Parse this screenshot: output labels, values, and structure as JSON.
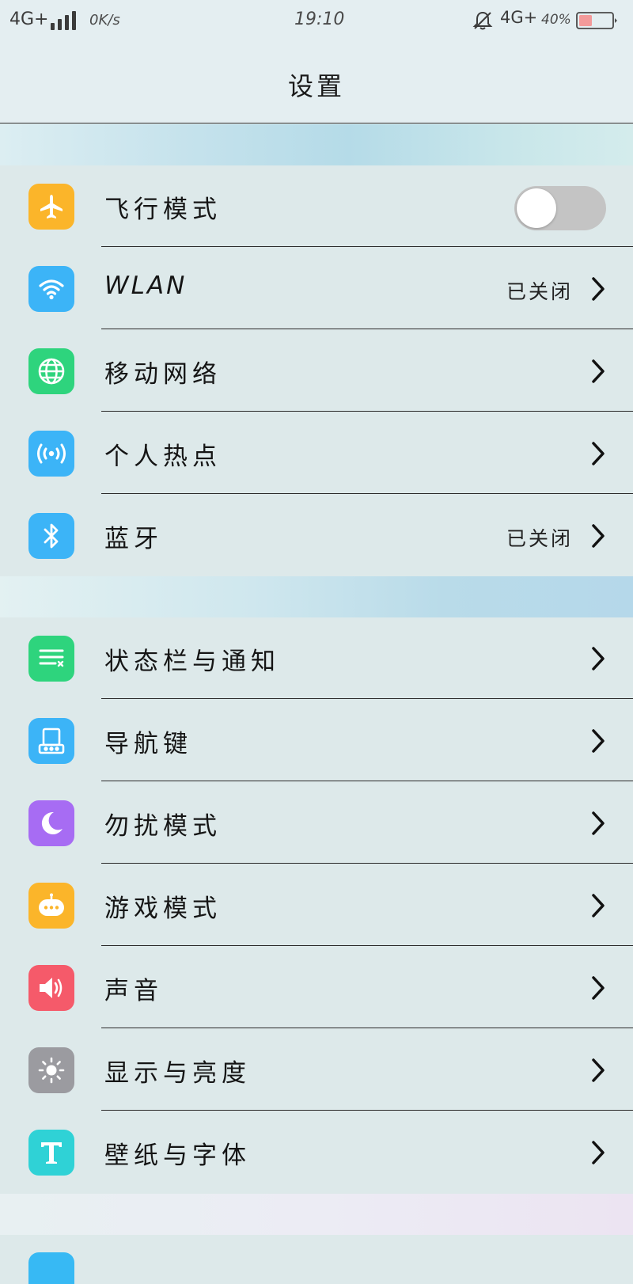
{
  "status_bar": {
    "network_left": "4G+",
    "speed": "0K/s",
    "time": "19:10",
    "network_right": "4G+",
    "battery_percent": "40%"
  },
  "header": {
    "title": "设置"
  },
  "group1": [
    {
      "label": "飞行模式",
      "icon": "airplane-icon",
      "color": "#fbb52a",
      "control": "toggle",
      "toggle_on": false
    },
    {
      "label": "WLAN",
      "icon": "wifi-icon",
      "color": "#3cb4f7",
      "value": "已关闭"
    },
    {
      "label": "移动网络",
      "icon": "globe-icon",
      "color": "#2ed47d"
    },
    {
      "label": "个人热点",
      "icon": "hotspot-icon",
      "color": "#3cb4f7"
    },
    {
      "label": "蓝牙",
      "icon": "bluetooth-icon",
      "color": "#3cb4f7",
      "value": "已关闭"
    }
  ],
  "group2": [
    {
      "label": "状态栏与通知",
      "icon": "notification-list-icon",
      "color": "#2ed47d"
    },
    {
      "label": "导航键",
      "icon": "navigation-key-icon",
      "color": "#3cb4f7"
    },
    {
      "label": "勿扰模式",
      "icon": "moon-icon",
      "color": "#a76cf3"
    },
    {
      "label": "游戏模式",
      "icon": "gamepad-icon",
      "color": "#fbb52a"
    },
    {
      "label": "声音",
      "icon": "speaker-icon",
      "color": "#f55a6a"
    },
    {
      "label": "显示与亮度",
      "icon": "brightness-icon",
      "color": "#9b9ba0"
    },
    {
      "label": "壁纸与字体",
      "icon": "font-icon",
      "color": "#2fd2d6"
    }
  ]
}
